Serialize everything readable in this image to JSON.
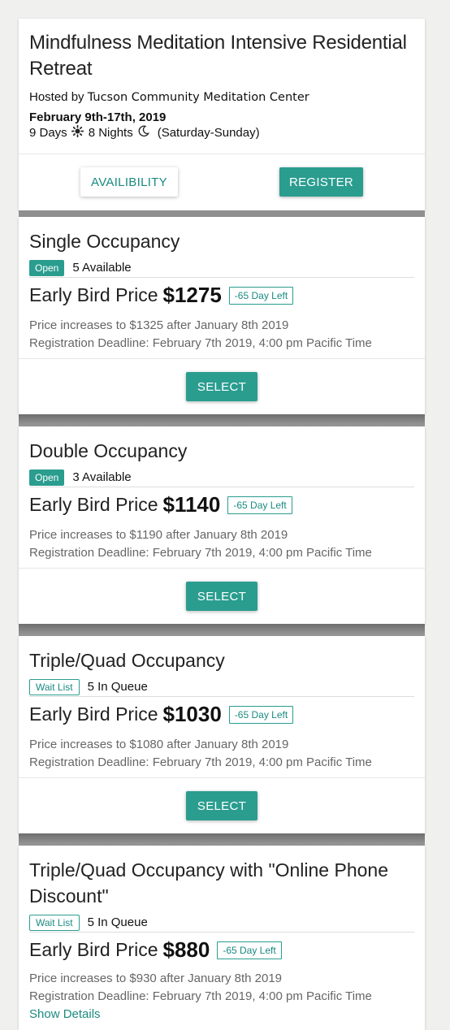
{
  "retreat": {
    "title": "Mindfulness Meditation Intensive Residential Retreat",
    "hosted_by_prefix": "Hosted by",
    "host": "Tucson Community Meditation Center",
    "dates": "February 9th-17th, 2019",
    "days": "9 Days",
    "nights": "8 Nights",
    "span": "(Saturday-Sunday)",
    "availability_label": "AVAILIBILITY",
    "register_label": "REGISTER"
  },
  "options": [
    {
      "title": "Single Occupancy",
      "status": "Open",
      "availability": "5 Available",
      "price_label": "Early Bird Price",
      "price": "$1275",
      "days_left": "-65 Day Left",
      "increase": "Price increases to $1325 after January 8th 2019",
      "deadline": "Registration Deadline: February 7th 2019, 4:00 pm Pacific Time",
      "select_label": "SELECT"
    },
    {
      "title": "Double Occupancy",
      "status": "Open",
      "availability": "3 Available",
      "price_label": "Early Bird Price",
      "price": "$1140",
      "days_left": "-65 Day Left",
      "increase": "Price increases to $1190 after January 8th 2019",
      "deadline": "Registration Deadline: February 7th 2019, 4:00 pm Pacific Time",
      "select_label": "SELECT"
    },
    {
      "title": "Triple/Quad Occupancy",
      "status": "Wait List",
      "availability": "5 In Queue",
      "price_label": "Early Bird Price",
      "price": "$1030",
      "days_left": "-65 Day Left",
      "increase": "Price increases to $1080 after January 8th 2019",
      "deadline": "Registration Deadline: February 7th 2019, 4:00 pm Pacific Time",
      "select_label": "SELECT"
    },
    {
      "title": "Triple/Quad Occupancy with \"Online Phone Discount\"",
      "status": "Wait List",
      "availability": "5 In Queue",
      "price_label": "Early Bird Price",
      "price": "$880",
      "days_left": "-65 Day Left",
      "increase": "Price increases to $930 after January 8th 2019",
      "deadline": "Registration Deadline: February 7th 2019, 4:00 pm Pacific Time",
      "show_details_label": "Show Details"
    }
  ],
  "colors": {
    "accent": "#2a9d8f",
    "band": "#8f8f8f"
  }
}
